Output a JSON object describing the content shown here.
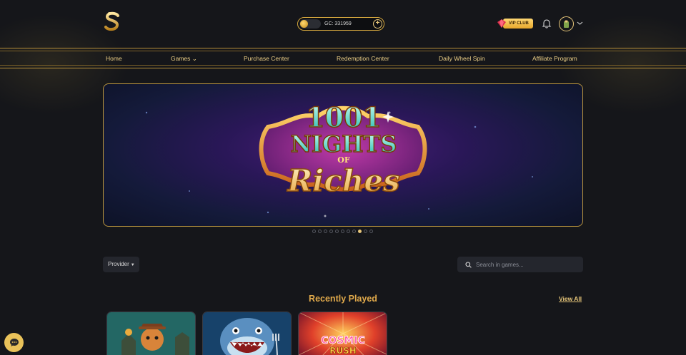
{
  "header": {
    "balance_text": "GC: 331959",
    "vip_label": "VIP CLUB"
  },
  "nav": {
    "items": [
      {
        "label": "Home"
      },
      {
        "label": "Games ⌄"
      },
      {
        "label": "Purchase Center"
      },
      {
        "label": "Redemption Center"
      },
      {
        "label": "Daily Wheel Spin"
      },
      {
        "label": "Affiliate Program"
      }
    ]
  },
  "banner": {
    "title_line1": "1001",
    "title_line2": "NIGHTS",
    "title_line3": "OF",
    "title_line4": "Riches",
    "active_slide": 9,
    "slide_count": 11
  },
  "filters": {
    "provider_label": "Provider",
    "search_placeholder": "Search in games..."
  },
  "recent": {
    "title": "Recently Played",
    "view_all": "View All",
    "games": [
      {
        "name": "game-card-1"
      },
      {
        "name": "game-card-2"
      },
      {
        "name": "game-card-3"
      }
    ]
  },
  "colors": {
    "background": "#15161a",
    "gold": "#e8c77a",
    "accent": "#e0a94b"
  },
  "icons": [
    "dollar-logo-icon",
    "coin-icon",
    "plus-icon",
    "gem-icon",
    "bell-icon",
    "avatar-icon",
    "chevron-down-icon",
    "search-icon",
    "chat-icon"
  ]
}
